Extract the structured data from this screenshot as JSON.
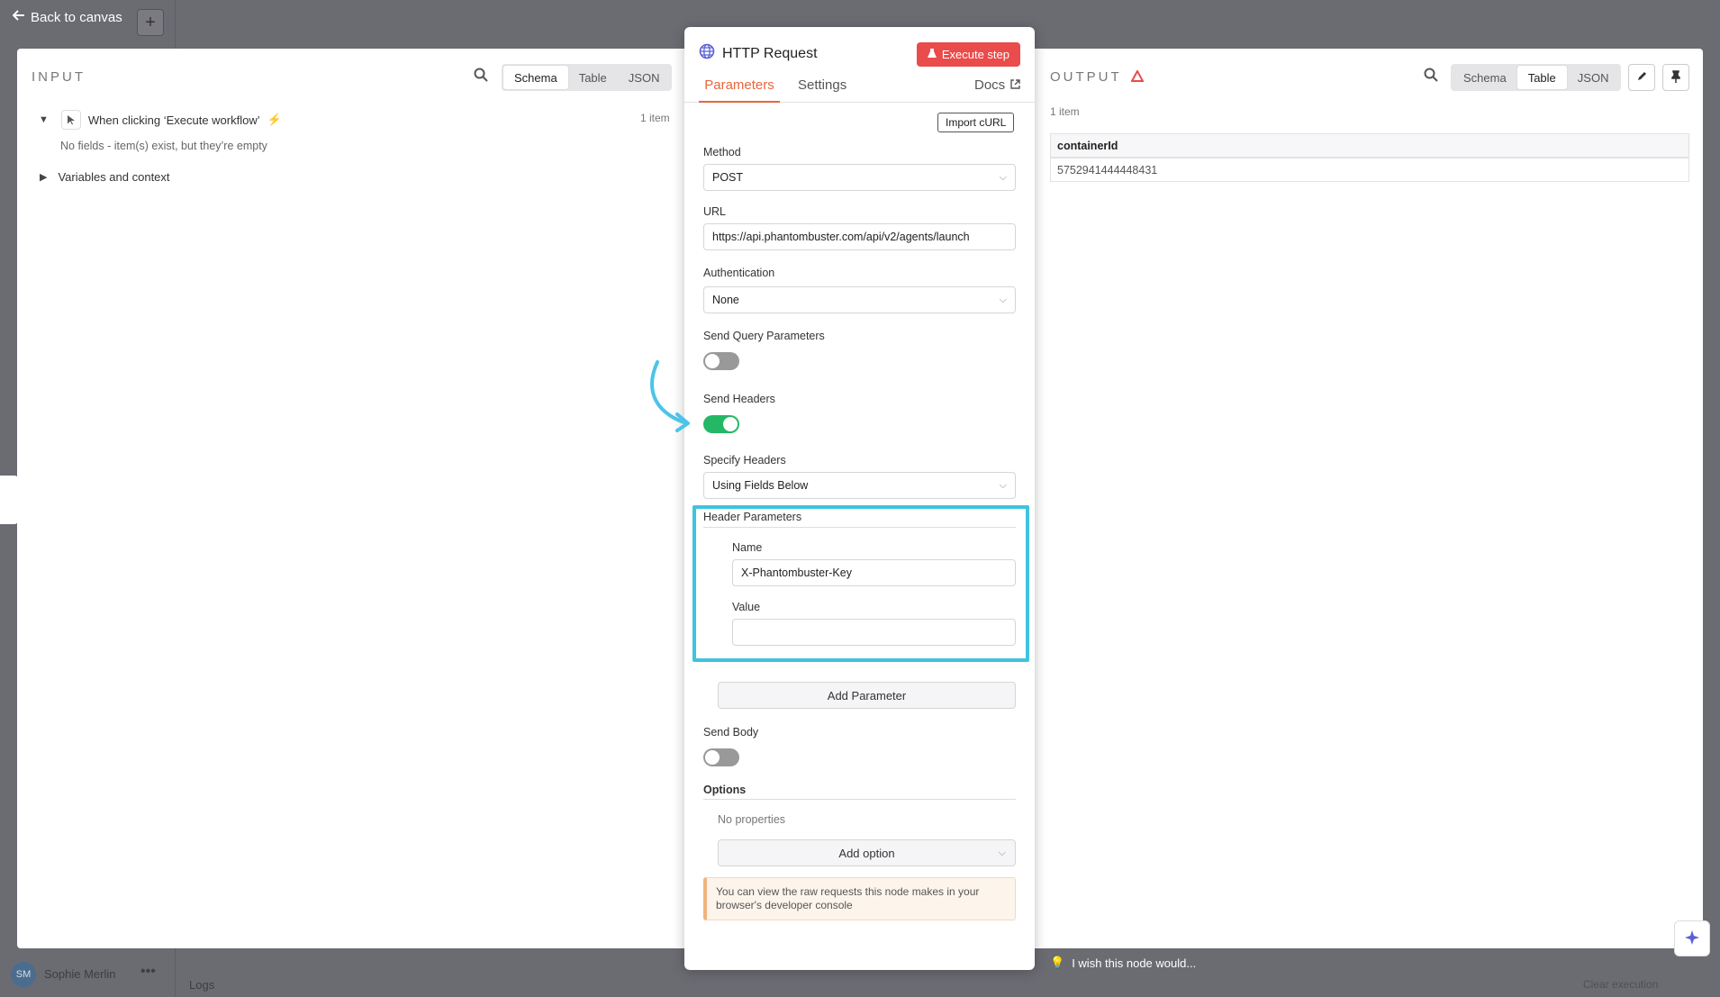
{
  "topbar": {
    "back_label": "Back to canvas",
    "add_label": "+"
  },
  "input": {
    "title": "INPUT",
    "views": [
      "Schema",
      "Table",
      "JSON"
    ],
    "active_view": "Schema",
    "trigger_name": "When clicking ‘Execute workflow’",
    "item_count": "1 item",
    "empty_note": "No fields - item(s) exist, but they’re empty",
    "variables_label": "Variables and context"
  },
  "node": {
    "title": "HTTP Request",
    "execute_label": "Execute step",
    "tabs": [
      "Parameters",
      "Settings"
    ],
    "docs_label": "Docs",
    "import_curl": "Import cURL",
    "method": {
      "label": "Method",
      "value": "POST"
    },
    "url": {
      "label": "URL",
      "value": "https://api.phantombuster.com/api/v2/agents/launch"
    },
    "auth": {
      "label": "Authentication",
      "value": "None"
    },
    "send_query": {
      "label": "Send Query Parameters",
      "on": false
    },
    "send_headers": {
      "label": "Send Headers",
      "on": true
    },
    "specify_headers": {
      "label": "Specify Headers",
      "value": "Using Fields Below"
    },
    "header_params": {
      "label": "Header Parameters",
      "name_label": "Name",
      "name_value": "X-Phantombuster-Key",
      "value_label": "Value",
      "value_value": ""
    },
    "add_parameter": "Add Parameter",
    "send_body": {
      "label": "Send Body",
      "on": false
    },
    "options": {
      "label": "Options",
      "empty": "No properties",
      "add_option": "Add option"
    },
    "note": "You can view the raw requests this node makes in your browser's developer console"
  },
  "output": {
    "title": "OUTPUT",
    "views": [
      "Schema",
      "Table",
      "JSON"
    ],
    "active_view": "Table",
    "item_count": "1 item",
    "column": "containerId",
    "value": "5752941444448431"
  },
  "footer": {
    "user_initials": "SM",
    "user_name": "Sophie Merlin",
    "logs_label": "Logs",
    "clear_label": "Clear execution",
    "feedback": "I wish this node would..."
  },
  "colors": {
    "accent": "#e8663b",
    "execute": "#ea4b4b",
    "toggle_on": "#24b866",
    "highlight": "#3fc3df",
    "arrow": "#4cc4e8"
  }
}
